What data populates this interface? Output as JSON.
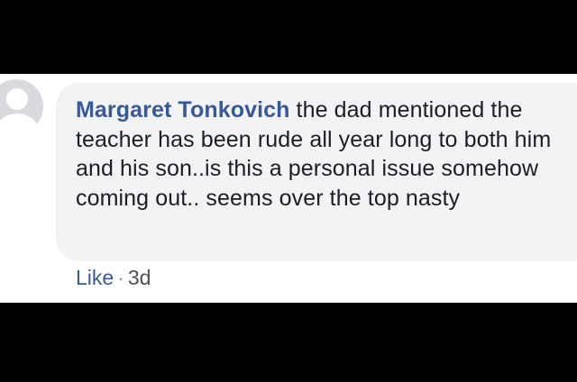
{
  "comment": {
    "author": "Margaret Tonkovich",
    "text": "the dad mentioned the teacher has been rude all year long to both him and his son..is this a personal issue somehow coming out.. seems over the top nasty"
  },
  "actions": {
    "like_label": "Like",
    "separator": "·",
    "timestamp": "3d"
  },
  "colors": {
    "author_link": "#385898",
    "bubble_bg": "#f2f3f5",
    "text": "#1c1e21",
    "letterbox": "#000000"
  },
  "icons": {
    "avatar": "default-profile-avatar-icon"
  }
}
